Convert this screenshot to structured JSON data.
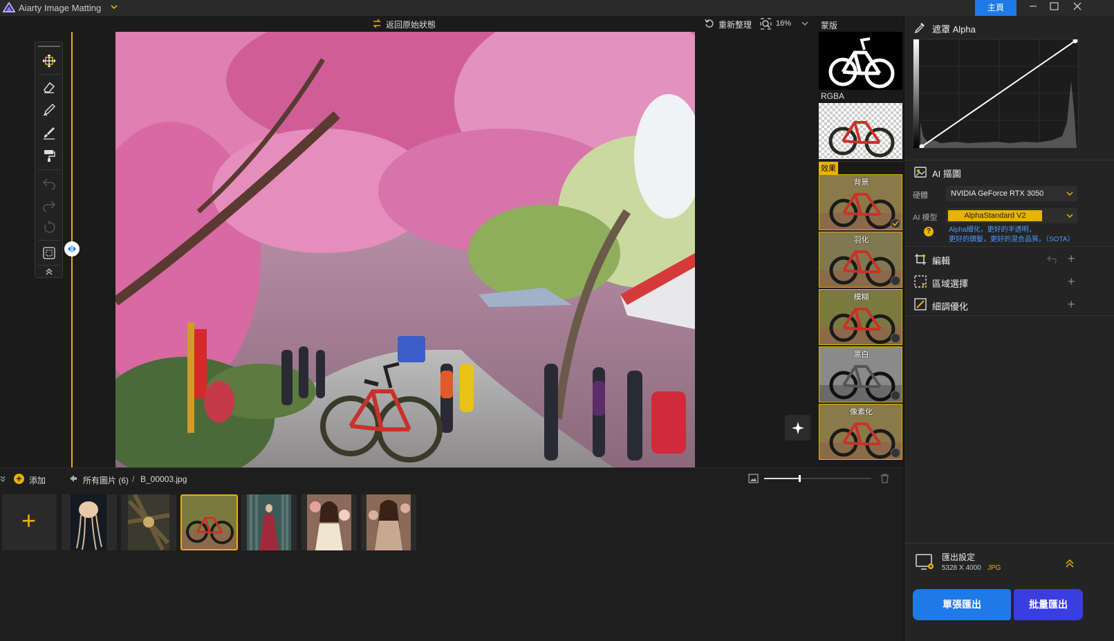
{
  "app": {
    "title": "Aiarty Image Matting",
    "home_label": "主頁"
  },
  "canvas": {
    "restore_label": "返回原始狀態",
    "refresh_label": "重新整理",
    "zoom_value": "16%"
  },
  "preview": {
    "mask_label": "蒙版",
    "rgba_label": "RGBA",
    "effects_label": "效果",
    "effects": [
      {
        "label": "背景",
        "selected": true
      },
      {
        "label": "羽化",
        "selected": false
      },
      {
        "label": "模糊",
        "selected": false
      },
      {
        "label": "黑白",
        "selected": false
      },
      {
        "label": "像素化",
        "selected": false
      }
    ]
  },
  "panel": {
    "alpha_title": "遮罩 Alpha",
    "ai_title": "AI 摳圖",
    "hardware_label": "硬體",
    "hardware_value": "NVIDIA GeForce RTX 3050",
    "model_label": "AI 模型",
    "model_value": "AlphaStandard  V2",
    "model_desc_line1": "Alpha細化，更好的半透明，",
    "model_desc_line2": "更好的頭髮，更好的混合品質。（SOTA）",
    "edit_label": "編輯",
    "region_label": "區域選擇",
    "refine_label": "細調優化",
    "export_title": "匯出設定",
    "export_size": "5328 X 4000",
    "export_format": "JPG",
    "single_export": "單張匯出",
    "batch_export": "批量匯出"
  },
  "bottom": {
    "add_label": "添加",
    "all_images": "所有圖片 (6)",
    "separator": "/",
    "current_file": "B_00003.jpg"
  },
  "colors": {
    "accent": "#e8b400",
    "blue": "#1e7ae6",
    "dark": "#1b1b1b"
  }
}
